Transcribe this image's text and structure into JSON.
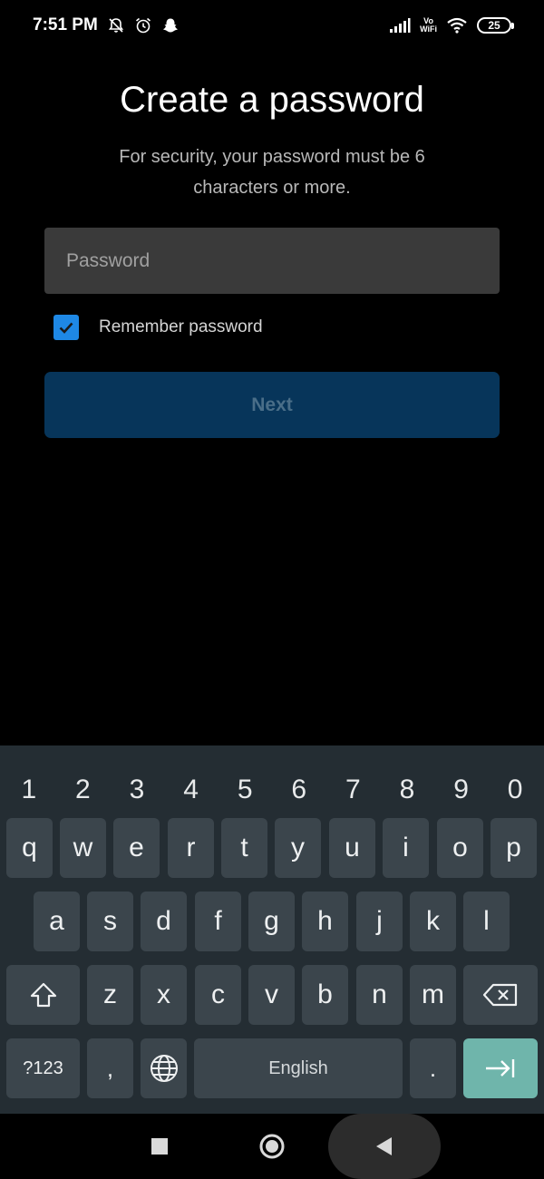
{
  "status_bar": {
    "time": "7:51 PM",
    "vo_label": "Vo",
    "wifi_label": "WiFi",
    "battery": "25",
    "icons": [
      "bell-off-icon",
      "alarm-icon",
      "snapchat-icon",
      "signal-icon",
      "wifi-icon",
      "battery-icon"
    ]
  },
  "screen": {
    "title": "Create a password",
    "subtitle": "For security, your password must be 6 characters or more.",
    "password_placeholder": "Password",
    "password_value": "",
    "remember_label": "Remember password",
    "remember_checked": true,
    "next_label": "Next"
  },
  "keyboard": {
    "numbers": [
      "1",
      "2",
      "3",
      "4",
      "5",
      "6",
      "7",
      "8",
      "9",
      "0"
    ],
    "row1": [
      "q",
      "w",
      "e",
      "r",
      "t",
      "y",
      "u",
      "i",
      "o",
      "p"
    ],
    "row2": [
      "a",
      "s",
      "d",
      "f",
      "g",
      "h",
      "j",
      "k",
      "l"
    ],
    "row3": [
      "z",
      "x",
      "c",
      "v",
      "b",
      "n",
      "m"
    ],
    "symbols_label": "?123",
    "comma": ",",
    "space_label": "English",
    "period": "."
  },
  "colors": {
    "accent_checkbox": "#1e88e5",
    "next_button_bg": "#07355a",
    "enter_key": "#6fb5ab"
  }
}
